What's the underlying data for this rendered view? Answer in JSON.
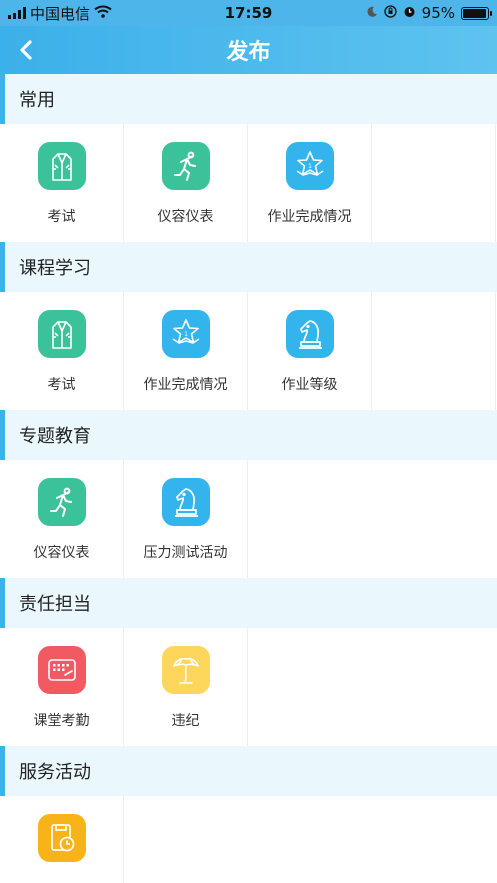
{
  "status": {
    "carrier": "中国电信",
    "time": "17:59",
    "battery": "95%",
    "battery_level": 0.95
  },
  "nav": {
    "title": "发布"
  },
  "colors": {
    "green": "#3cc29a",
    "blue": "#33b4ec",
    "red": "#f25a63",
    "yellow": "#ffd65c",
    "orange": "#f7b318"
  },
  "sections": [
    {
      "title": "常用",
      "items": [
        {
          "label": "考试",
          "icon": "suit-icon"
        },
        {
          "label": "仪容仪表",
          "icon": "runner-icon"
        },
        {
          "label": "作业完成情况",
          "icon": "star-badge-icon"
        }
      ]
    },
    {
      "title": "课程学习",
      "items": [
        {
          "label": "考试",
          "icon": "suit-icon"
        },
        {
          "label": "作业完成情况",
          "icon": "star-badge-icon"
        },
        {
          "label": "作业等级",
          "icon": "chess-knight-icon"
        }
      ]
    },
    {
      "title": "专题教育",
      "items": [
        {
          "label": "仪容仪表",
          "icon": "runner-icon"
        },
        {
          "label": "压力测试活动",
          "icon": "chess-knight-icon"
        }
      ]
    },
    {
      "title": "责任担当",
      "items": [
        {
          "label": "课堂考勤",
          "icon": "keyboard-icon"
        },
        {
          "label": "违纪",
          "icon": "palm-tree-icon"
        }
      ]
    },
    {
      "title": "服务活动",
      "items": [
        {
          "label": "",
          "icon": "clock-doc-icon"
        }
      ]
    }
  ]
}
